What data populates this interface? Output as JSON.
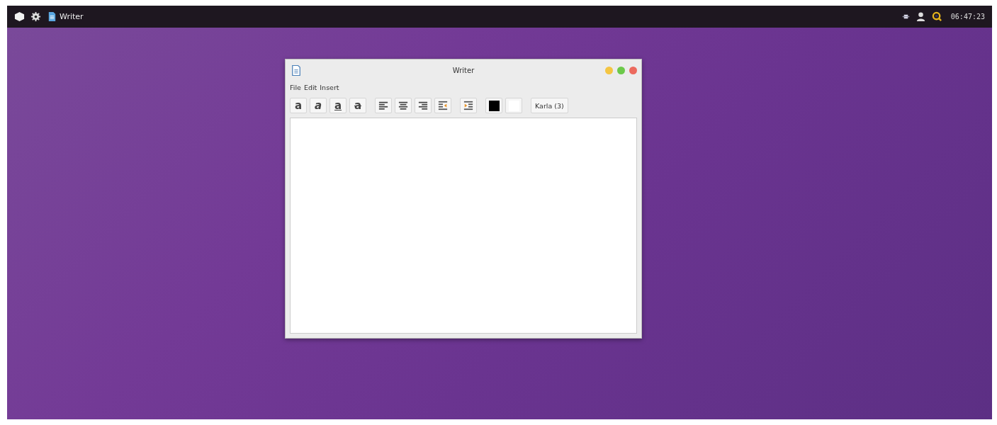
{
  "taskbar": {
    "app_label": "Writer",
    "clock": "06:47:23"
  },
  "window": {
    "title": "Writer"
  },
  "menu": [
    "File",
    "Edit",
    "Insert"
  ],
  "toolbar": [
    {
      "kind": "bold",
      "glyph": "a"
    },
    {
      "kind": "italic",
      "glyph": "a"
    },
    {
      "kind": "underline",
      "glyph": "a"
    },
    {
      "kind": "strike",
      "glyph": "a"
    },
    {
      "kind": "align-left"
    },
    {
      "kind": "align-center"
    },
    {
      "kind": "align-right"
    },
    {
      "kind": "outdent"
    },
    {
      "kind": "indent"
    },
    {
      "kind": "color",
      "color": "#000000"
    },
    {
      "kind": "color",
      "color": "#ffffff"
    },
    {
      "kind": "font",
      "label": "Karla (3)"
    }
  ]
}
